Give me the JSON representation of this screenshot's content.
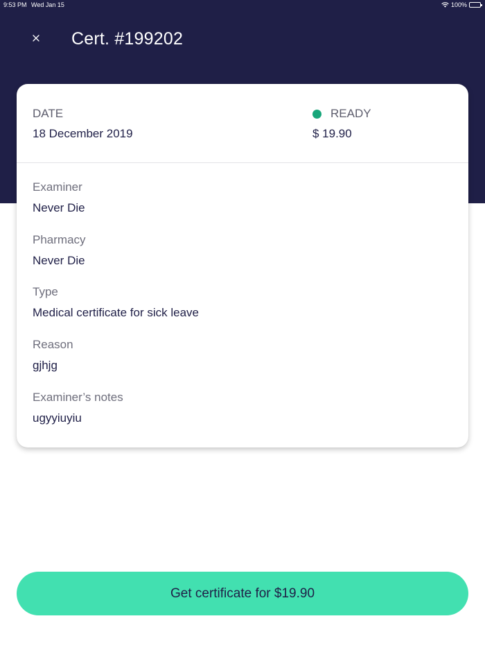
{
  "status_bar": {
    "time": "9:53 PM",
    "date": "Wed Jan 15",
    "battery": "100%",
    "battery_level": 1.0
  },
  "header": {
    "title": "Cert. #199202",
    "close_icon": "close-icon"
  },
  "card": {
    "date_label": "DATE",
    "date_value": "18 December 2019",
    "status_label": "READY",
    "status_color": "#18a67a",
    "price": "$ 19.90",
    "fields": [
      {
        "label": "Examiner",
        "value": "Never Die"
      },
      {
        "label": "Pharmacy",
        "value": "Never Die"
      },
      {
        "label": "Type",
        "value": "Medical certificate for sick leave"
      },
      {
        "label": "Reason",
        "value": "gjhjg"
      },
      {
        "label": "Examiner’s notes",
        "value": "ugyyiuyiu"
      }
    ]
  },
  "cta": {
    "label": "Get certificate for $19.90"
  },
  "colors": {
    "header_bg": "#1f1f47",
    "accent": "#42e0b0",
    "ready_dot": "#18a67a",
    "text_dark": "#1f1f47",
    "text_muted": "#6e6e7c"
  }
}
